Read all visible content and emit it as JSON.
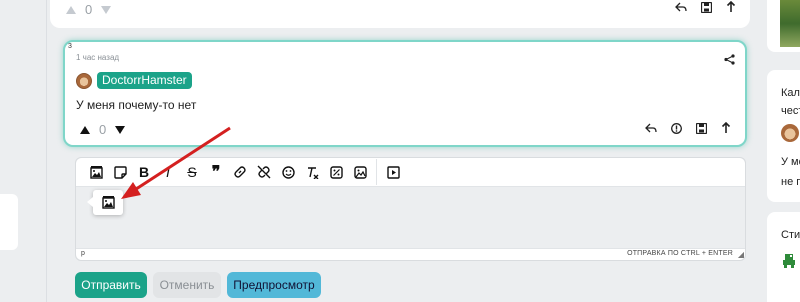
{
  "prev_comment": {
    "score": "0"
  },
  "comment": {
    "index": "3",
    "time": "1 час назад",
    "author": "DoctorrHamster",
    "text": "У меня почему-то нет",
    "score": "0"
  },
  "editor": {
    "toolbar_items": [
      "image-icon",
      "sticker-icon",
      "bold-icon",
      "italic-icon",
      "strikethrough-icon",
      "quote-icon",
      "link-icon",
      "unlink-icon",
      "emoji-icon",
      "clear-format-icon",
      "spoiler-icon",
      "image-gallery-icon",
      "video-icon"
    ],
    "bold_glyph": "B",
    "italic_glyph": "I",
    "strike_glyph": "S",
    "quote_glyph": "❞",
    "path": "p",
    "hint": "ОТПРАВКА ПО CTRL + ENTER"
  },
  "buttons": {
    "send": "Отправить",
    "cancel": "Отменить",
    "preview": "Предпросмотр"
  },
  "sidebar": {
    "card2_line1": "Кал",
    "card2_line2": "чест",
    "card2_line3": "У ме",
    "card2_line4": "не п",
    "card3_line1": "Сти"
  },
  "colors": {
    "accent": "#1ba389",
    "preview": "#52b8d8",
    "annotation_arrow": "#d42020"
  }
}
